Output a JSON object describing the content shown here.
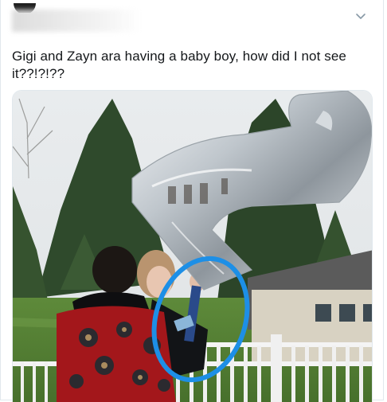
{
  "tweet": {
    "text": "Gigi and Zayn ara having a baby boy, how did I not see it??!?!??",
    "menu_icon": "chevron-down-icon",
    "photo": {
      "description_icon": "photo",
      "balloon_letter": "?"
    }
  },
  "colors": {
    "annotation_circle": "#1d8fe6",
    "text": "#14171a",
    "border": "#e1e8ed"
  }
}
